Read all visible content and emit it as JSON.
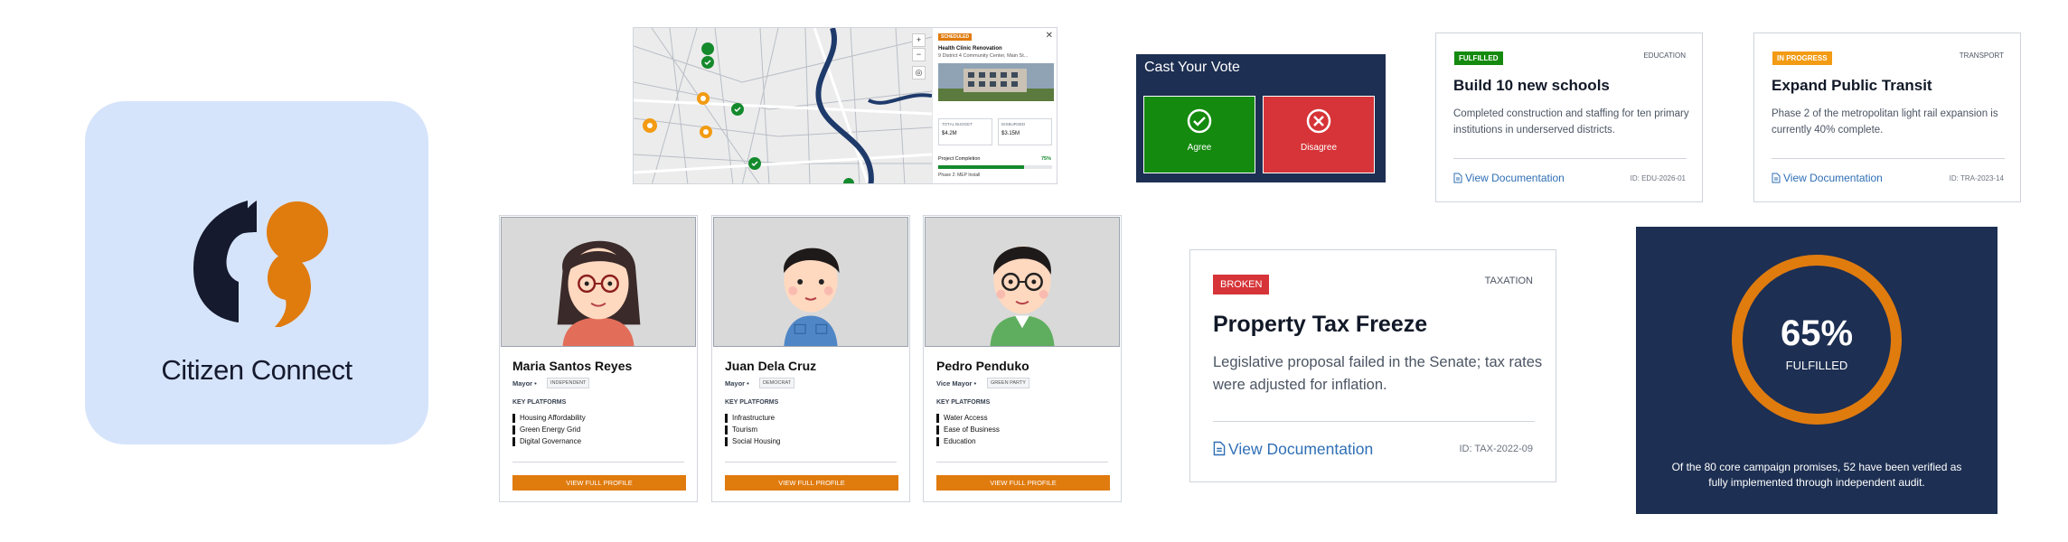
{
  "app": {
    "name": "Citizen Connect",
    "logo_colors": {
      "dark": "#151a2e",
      "accent": "#e07b0e",
      "tile": "#d6e4fb"
    }
  },
  "map_card": {
    "tag": "SCHEDULED",
    "close_icon": "close-icon",
    "title": "Health Clinic Renovation",
    "address": "9 District 4 Community Center, Main St...",
    "kpis": [
      {
        "label": "TOTAL BUDGET",
        "value": "$4.2M"
      },
      {
        "label": "DISBURSED",
        "value": "$3.15M"
      }
    ],
    "completion_label": "Project Completion",
    "completion_value": "75%",
    "completion_fraction": 0.75,
    "phase": "Phase 2: MEP Install",
    "zoom_in": "+",
    "zoom_out": "−",
    "locate_icon": "locate-icon"
  },
  "vote": {
    "title": "Cast Your Vote",
    "agree_label": "Agree",
    "disagree_label": "Disagree",
    "agree_color": "#148a0e",
    "disagree_color": "#d63438"
  },
  "promises_small": [
    {
      "status": "FULFILLED",
      "status_color": "#148a0e",
      "category": "EDUCATION",
      "title": "Build 10 new schools",
      "description": "Completed construction and staffing for ten primary institutions in underserved districts.",
      "link": "View Documentation",
      "id": "ID: EDU-2026-01"
    },
    {
      "status": "IN PROGRESS",
      "status_color": "#f29b13",
      "category": "TRANSPORT",
      "title": "Expand Public Transit",
      "description": "Phase 2 of the metropolitan light rail expansion is currently 40% complete.",
      "link": "View Documentation",
      "id": "ID: TRA-2023-14"
    }
  ],
  "promise_large": {
    "status": "BROKEN",
    "status_color": "#d63438",
    "category": "TAXATION",
    "title": "Property Tax Freeze",
    "description": "Legislative proposal failed in the Senate; tax rates were adjusted for inflation.",
    "link": "View Documentation",
    "id": "ID: TAX-2022-09"
  },
  "candidates": [
    {
      "name": "Maria Santos Reyes",
      "role": "Mayor",
      "party": "INDEPENDENT",
      "platforms_label": "KEY PLATFORMS",
      "platforms": [
        "Housing Affordability",
        "Green Energy Grid",
        "Digital Governance"
      ],
      "button": "VIEW FULL PROFILE"
    },
    {
      "name": "Juan Dela Cruz",
      "role": "Mayor",
      "party": "DEMOCRAT",
      "platforms_label": "KEY PLATFORMS",
      "platforms": [
        "Infrastructure",
        "Tourism",
        "Social Housing"
      ],
      "button": "VIEW FULL PROFILE"
    },
    {
      "name": "Pedro Penduko",
      "role": "Vice Mayor",
      "party": "GREEN PARTY",
      "platforms_label": "KEY PLATFORMS",
      "platforms": [
        "Water Access",
        "Ease of Business",
        "Education"
      ],
      "button": "VIEW FULL PROFILE"
    }
  ],
  "progress": {
    "percent_text": "65%",
    "fraction": 0.65,
    "label": "FULFILLED",
    "caption": "Of the 80 core campaign promises, 52 have been verified as fully implemented through independent audit.",
    "ring_color": "#e07b0e"
  }
}
